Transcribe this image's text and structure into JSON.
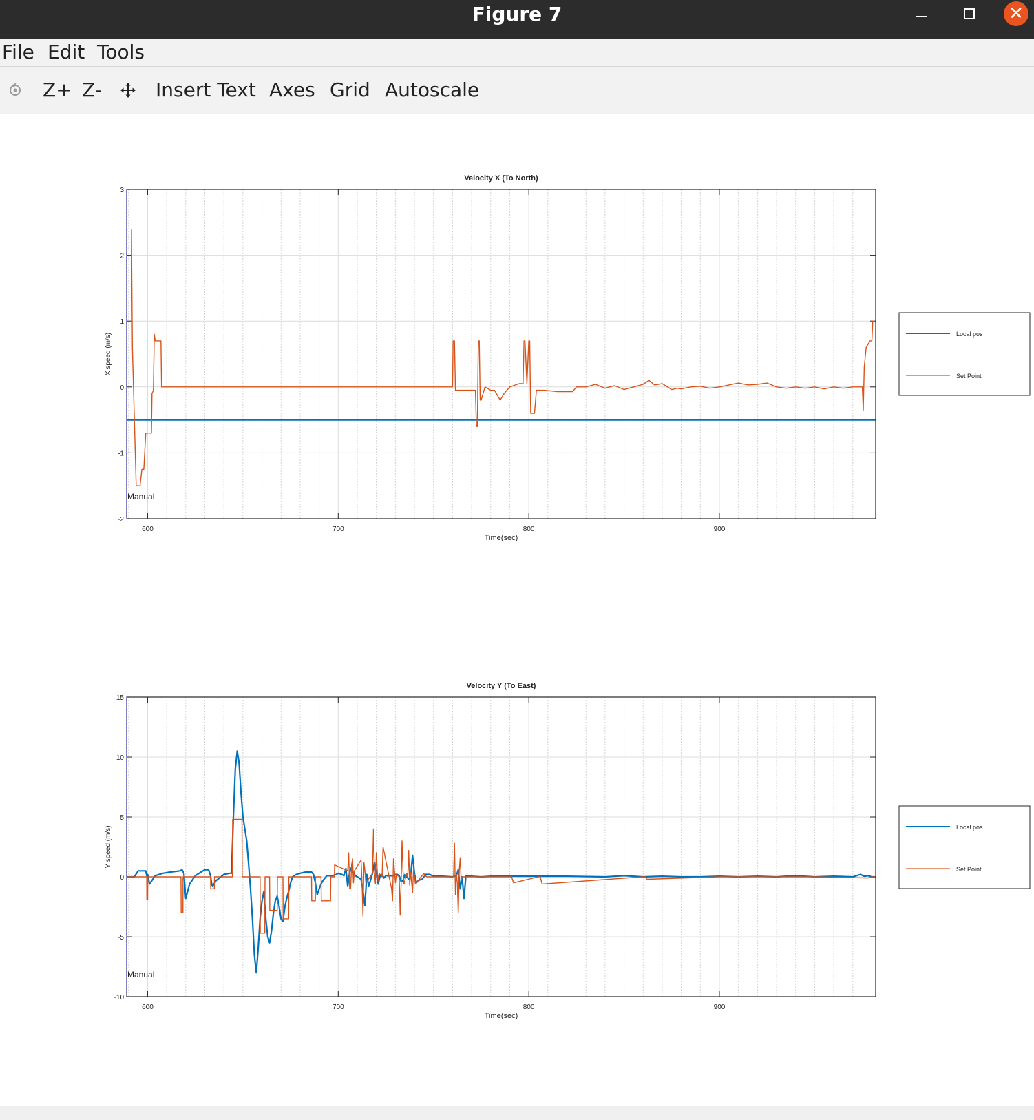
{
  "window": {
    "title": "Figure 7",
    "icons": {
      "minimize": "minimize-icon",
      "maximize": "maximize-icon",
      "close": "close-icon"
    },
    "close_glyph": "✕"
  },
  "menu": {
    "file": "File",
    "edit": "Edit",
    "tools": "Tools"
  },
  "toolbar": {
    "rotate_icon": "rotate-icon",
    "zoom_in": "Z+",
    "zoom_out": "Z-",
    "pan_icon": "pan-icon",
    "insert_text": "Insert Text",
    "axes": "Axes",
    "grid": "Grid",
    "autoscale": "Autoscale"
  },
  "colors": {
    "local_pos": "#0072BD",
    "set_point": "#D95319",
    "window_titlebar": "#2c2c2c",
    "close_button": "#e95420",
    "toolbar_bg": "#f2f2f2"
  },
  "chart_data": [
    {
      "type": "line",
      "title": "Velocity X (To North)",
      "xlabel": "Time(sec)",
      "ylabel": "X speed (m/s)",
      "xlim": [
        589,
        982
      ],
      "ylim": [
        -2,
        3
      ],
      "xticks": [
        600,
        700,
        800,
        900
      ],
      "yticks": [
        -2,
        -1,
        0,
        1,
        2,
        3
      ],
      "grid": true,
      "minor_x_grid": true,
      "legend": {
        "placement": "right-outside",
        "entries": [
          "Local pos",
          "Set Point"
        ]
      },
      "annotation": "Manual",
      "series": [
        {
          "name": "Local pos",
          "color": "#0072BD",
          "x": [
            589,
            982
          ],
          "y": [
            -0.5,
            -0.5
          ]
        },
        {
          "name": "Set Point",
          "color": "#D95319",
          "x": [
            591.5,
            592,
            594,
            595,
            596,
            597,
            598,
            599,
            599.3,
            602,
            602.3,
            603,
            603.5,
            604,
            605,
            606,
            607,
            607.3,
            608,
            610,
            700,
            760,
            760.3,
            761,
            761.5,
            762,
            768,
            772,
            772.5,
            773,
            773.5,
            774,
            774.5,
            775,
            777,
            780,
            782,
            785,
            787,
            790,
            795,
            797,
            797.5,
            798,
            799,
            800,
            800.5,
            801,
            803,
            804,
            806,
            808,
            815,
            823,
            825,
            830,
            835,
            840,
            845,
            850,
            855,
            860,
            863,
            866,
            870,
            875,
            878,
            880,
            885,
            890,
            895,
            900,
            905,
            910,
            915,
            920,
            925,
            930,
            935,
            940,
            945,
            950,
            955,
            960,
            965,
            970,
            974,
            975,
            975.5,
            976,
            977,
            979,
            980,
            980.5,
            981
          ],
          "y": [
            2.4,
            0.6,
            -1.5,
            -1.5,
            -1.5,
            -1.25,
            -1.25,
            -0.7,
            -0.7,
            -0.7,
            -0.1,
            -0.05,
            0.8,
            0.7,
            0.7,
            0.7,
            0.7,
            0.0,
            0.0,
            0.0,
            0.0,
            0.0,
            0.7,
            0.7,
            -0.05,
            -0.05,
            -0.05,
            -0.05,
            -0.6,
            -0.6,
            0.7,
            0.7,
            -0.2,
            -0.2,
            0.0,
            -0.05,
            -0.05,
            -0.2,
            -0.1,
            0.0,
            0.05,
            0.05,
            0.7,
            0.7,
            0.05,
            0.7,
            0.7,
            -0.4,
            -0.4,
            -0.05,
            -0.05,
            -0.05,
            -0.07,
            -0.07,
            0.0,
            0.0,
            0.04,
            -0.02,
            0.02,
            -0.04,
            0.0,
            0.04,
            0.1,
            0.03,
            0.05,
            -0.04,
            -0.02,
            -0.03,
            0.0,
            0.01,
            -0.02,
            0.0,
            0.03,
            0.06,
            0.03,
            0.04,
            0.06,
            0.0,
            -0.02,
            0.0,
            -0.02,
            0.0,
            -0.03,
            0.0,
            -0.02,
            0.0,
            0.0,
            0.0,
            -0.35,
            0.3,
            0.6,
            0.7,
            0.7,
            1.0,
            1.0
          ]
        }
      ]
    },
    {
      "type": "line",
      "title": "Velocity Y (To East)",
      "xlabel": "Time(sec)",
      "ylabel": "Y speed (m/s)",
      "xlim": [
        589,
        982
      ],
      "ylim": [
        -10,
        15
      ],
      "xticks": [
        600,
        700,
        800,
        900
      ],
      "yticks": [
        -10,
        -5,
        0,
        5,
        10,
        15
      ],
      "grid": true,
      "minor_x_grid": true,
      "legend": {
        "placement": "right-outside",
        "entries": [
          "Local pos",
          "Set Point"
        ]
      },
      "annotation": "Manual",
      "series": [
        {
          "name": "Local pos",
          "color": "#0072BD",
          "x": [
            589,
            593,
            595,
            599,
            599.5,
            600,
            601,
            604,
            608,
            612,
            617,
            618,
            619,
            620,
            622,
            625,
            630,
            632,
            633,
            633.5,
            634,
            636,
            640,
            643,
            644,
            645,
            646,
            647,
            648,
            649,
            650,
            652,
            653,
            654,
            655,
            656,
            657,
            658,
            659,
            660,
            661,
            662,
            663,
            664,
            665,
            666,
            667,
            668,
            669,
            670,
            671,
            672,
            673,
            674,
            675,
            676,
            678,
            680,
            683,
            686,
            687,
            688,
            689,
            690,
            691,
            692,
            694,
            697,
            699,
            700,
            702,
            703,
            704,
            705,
            706,
            707,
            708,
            709,
            710,
            712,
            713,
            714,
            715,
            716,
            718,
            719,
            720,
            721,
            722,
            723,
            724,
            725,
            727,
            729,
            730,
            731,
            732,
            733,
            734,
            735,
            737,
            738,
            739,
            740,
            741,
            742,
            744,
            746,
            748,
            750,
            755,
            760,
            762,
            763,
            764,
            765,
            766,
            767,
            768,
            770,
            775,
            780,
            800,
            820,
            840,
            850,
            860,
            870,
            880,
            890,
            900,
            910,
            920,
            930,
            940,
            950,
            960,
            970,
            974,
            976,
            978,
            980,
            982
          ],
          "y": [
            0,
            0,
            0.5,
            0.5,
            0.1,
            0.2,
            -0.6,
            0.1,
            0.3,
            0.4,
            0.5,
            0.6,
            0.3,
            -1.8,
            -0.6,
            0.1,
            0.6,
            0.6,
            0.1,
            -0.5,
            -0.8,
            -0.3,
            0.2,
            0.3,
            0.3,
            5,
            9,
            10.5,
            9.5,
            7,
            5,
            3,
            1,
            -1,
            -3.5,
            -6.5,
            -8,
            -6,
            -3.5,
            -2,
            -1.2,
            -3.5,
            -5,
            -5.5,
            -4.5,
            -3,
            -2,
            -1.6,
            -2.5,
            -3.5,
            -3.7,
            -2.5,
            -1.8,
            -1.2,
            -0.5,
            0,
            0.2,
            0.3,
            0.4,
            0.4,
            0.2,
            -0.5,
            -1.5,
            -1,
            -0.6,
            -0.3,
            0.1,
            0.1,
            0.2,
            0.3,
            0.2,
            0.1,
            0.7,
            -0.8,
            0.4,
            0.8,
            0.3,
            0.1,
            0.0,
            -0.2,
            -1.2,
            -2.4,
            0.2,
            -0.8,
            0.3,
            1.2,
            0.3,
            -0.6,
            0.1,
            0.2,
            -0.1,
            0.1,
            0.1,
            0.1,
            0.2,
            0.2,
            0.1,
            -0.4,
            -0.3,
            0.2,
            -0.2,
            0.1,
            1.8,
            0.3,
            -0.5,
            -0.3,
            -0.2,
            0.2,
            0.2,
            0.05,
            0.05,
            0.0,
            0.1,
            0.6,
            -1,
            0.0,
            -1.8,
            0.1,
            0.05,
            0.05,
            0.0,
            0.05,
            0.05,
            0.05,
            0.0,
            0.1,
            0.0,
            0.05,
            0.0,
            0.0,
            0.05,
            0.0,
            0.05,
            0.0,
            0.1,
            0.0,
            0.05,
            0.0,
            0.2,
            0.05,
            0.1,
            0.0,
            0.0
          ]
        },
        {
          "name": "Set Point",
          "color": "#D95319",
          "x": [
            589,
            599.5,
            599.6,
            600,
            600.1,
            600.4,
            600.5,
            617.5,
            617.6,
            618.5,
            618.6,
            633,
            633.1,
            635,
            635.1,
            644.5,
            644.6,
            649.5,
            649.6,
            659,
            659.1,
            661.5,
            661.6,
            664,
            664.1,
            668,
            668.1,
            671,
            671.1,
            674,
            674.1,
            686,
            686.1,
            688,
            688.1,
            691,
            691.1,
            696,
            696.1,
            698,
            698.1,
            705,
            705.5,
            706,
            706.5,
            707,
            707.5,
            708,
            708.5,
            712,
            712.5,
            713,
            713.5,
            714,
            714.5,
            718,
            718.5,
            719,
            719.5,
            720,
            720.5,
            721,
            721.5,
            723,
            723.5,
            728,
            728.5,
            729,
            729.5,
            730,
            730.5,
            732,
            732.5,
            733,
            733.5,
            734,
            734.5,
            736,
            736.5,
            737,
            737.5,
            738,
            738.5,
            739,
            739.5,
            740,
            740.5,
            745,
            745.5,
            746,
            746.5,
            747,
            747.5,
            760,
            760.5,
            761,
            761.5,
            762,
            762.5,
            763,
            763.5,
            764,
            764.5,
            765,
            765.5,
            766,
            766.5,
            767,
            767.5,
            768,
            768.5,
            790,
            791,
            792,
            805,
            806,
            807,
            860,
            861,
            862,
            900,
            950,
            978,
            980,
            982
          ],
          "y": [
            0,
            0,
            -1.9,
            -1.9,
            0,
            0,
            0,
            0,
            -3,
            -3,
            0,
            0,
            -1,
            -1,
            0,
            0,
            4.8,
            4.8,
            0,
            0,
            -4.7,
            -4.7,
            0,
            0,
            -2.8,
            -2.8,
            0,
            0,
            -3.5,
            -3.5,
            0,
            0,
            -2,
            -2,
            0,
            0,
            -2,
            -2,
            0,
            0,
            1,
            0.5,
            2,
            -1,
            -1,
            1,
            1.5,
            -0.5,
            0.5,
            1.4,
            -0.5,
            -3.3,
            1.2,
            0.5,
            -0.5,
            0.3,
            4,
            0.4,
            -0.6,
            2,
            0.4,
            -0.3,
            0.3,
            0,
            2.5,
            -1,
            -2,
            1.5,
            0.5,
            -0.5,
            0.2,
            0,
            -3.2,
            -0.5,
            3,
            0.5,
            -0.6,
            0.3,
            0,
            2.2,
            -0.7,
            0.4,
            -0.5,
            -1.3,
            0.6,
            0.1,
            -0.6,
            0.3,
            0,
            0.1,
            0,
            0,
            0,
            0,
            0,
            2.8,
            -1.5,
            0.2,
            -0.5,
            -3,
            0.5,
            1.6,
            -0.3,
            0,
            0,
            0,
            0,
            0,
            0,
            0,
            0,
            0,
            0,
            -0.5,
            0,
            0,
            -0.6,
            0,
            0,
            -0.2,
            0,
            0,
            -0.1,
            0,
            0
          ]
        }
      ]
    }
  ]
}
